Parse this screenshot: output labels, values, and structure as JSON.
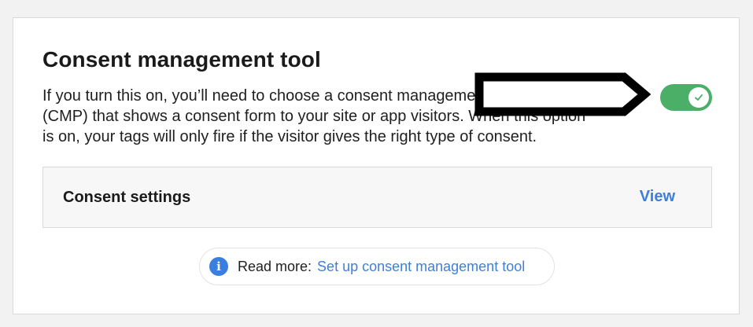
{
  "section": {
    "title": "Consent management tool",
    "description": "If you turn this on, you’ll need to choose a consent management platform (CMP) that shows a consent form to your site or app visitors. When this option is on, your tags will only fire if the visitor gives the right type of consent.",
    "toggle": {
      "state": "on",
      "on_color": "#4caf68",
      "icon": "check-icon"
    }
  },
  "consent_settings": {
    "label": "Consent settings",
    "action": "View"
  },
  "read_more": {
    "icon": "info-icon",
    "icon_glyph": "i",
    "label": "Read more:",
    "link_text": "Set up consent management tool"
  },
  "colors": {
    "accent": "#3e7fd9",
    "info": "#3a7ee0"
  }
}
